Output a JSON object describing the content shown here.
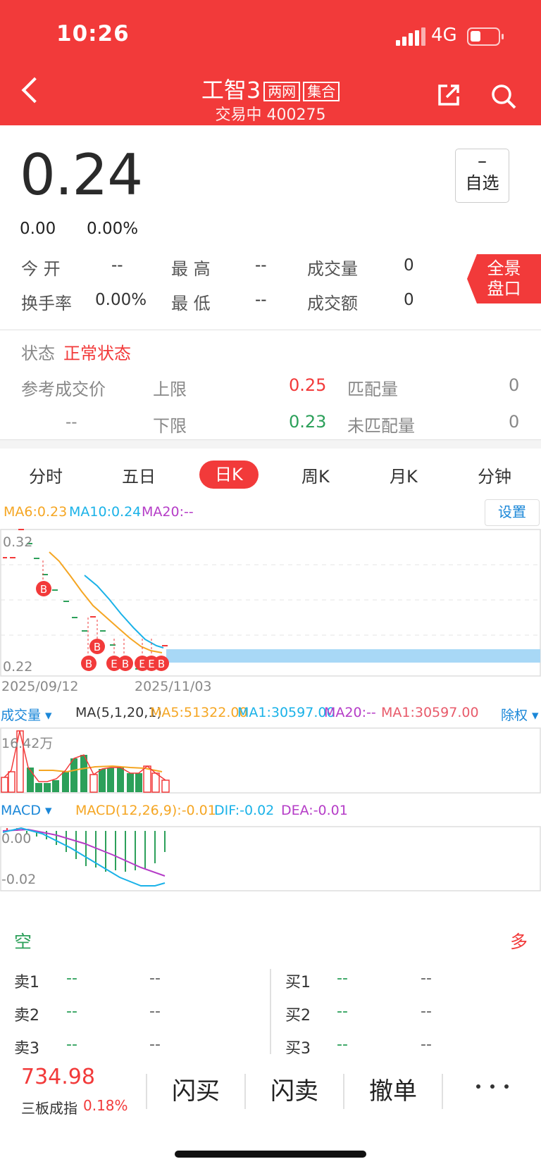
{
  "status_bar": {
    "time": "10:26",
    "network": "4G"
  },
  "header": {
    "title": "工智3",
    "tags": [
      "两网",
      "集合"
    ],
    "subtitle": "交易中 400275"
  },
  "quote": {
    "price": "0.24",
    "change": "0.00",
    "change_pct": "0.00%",
    "fav_mark": "–",
    "fav_label": "自选"
  },
  "stats": {
    "open_label": "今  开",
    "open": "--",
    "high_label": "最  高",
    "high": "--",
    "vol_label": "成交量",
    "vol": "0",
    "turnover_label": "换手率",
    "turnover": "0.00%",
    "low_label": "最  低",
    "low": "--",
    "amt_label": "成交额",
    "amt": "0",
    "panorama": [
      "全景",
      "盘口"
    ]
  },
  "status": {
    "label": "状态",
    "value": "正常状态",
    "ref_label": "参考成交价",
    "ref_value": "--",
    "upper_label": "上限",
    "upper": "0.25",
    "lower_label": "下限",
    "lower": "0.23",
    "matched_label": "匹配量",
    "matched": "0",
    "unmatched_label": "未匹配量",
    "unmatched": "0"
  },
  "tabs": [
    "分时",
    "五日",
    "日K",
    "周K",
    "月K",
    "分钟"
  ],
  "ma_line": {
    "ma6": "MA6:0.23",
    "ma10": "MA10:0.24",
    "ma20": "MA20:--",
    "settings": "设置"
  },
  "kchart": {
    "y_top": "0.32",
    "y_bottom": "0.22",
    "date_left": "2025/09/12",
    "date_right": "2025/11/03"
  },
  "volume": {
    "label": "成交量 ▾",
    "params": "MA(5,1,20,1)",
    "ma5": "MA5:51322.00",
    "ma1": "MA1:30597.00",
    "ma20": "MA20:--",
    "ma1b": "MA1:30597.00",
    "adj": "除权 ▾",
    "y_top": "16.42万"
  },
  "macd": {
    "label": "MACD ▾",
    "params": "MACD(12,26,9):-0.01",
    "dif": "DIF:-0.02",
    "dea": "DEA:-0.01",
    "y_top": "0.00",
    "y_bottom": "-0.02"
  },
  "orderbook": {
    "empty": "空",
    "long": "多",
    "sell": [
      {
        "label": "卖1",
        "price": "--",
        "vol": "--"
      },
      {
        "label": "卖2",
        "price": "--",
        "vol": "--"
      },
      {
        "label": "卖3",
        "price": "--",
        "vol": "--"
      }
    ],
    "buy": [
      {
        "label": "买1",
        "price": "--",
        "vol": "--"
      },
      {
        "label": "买2",
        "price": "--",
        "vol": "--"
      },
      {
        "label": "买3",
        "price": "--",
        "vol": "--"
      }
    ]
  },
  "bottom": {
    "index_value": "734.98",
    "index_name": "三板成指",
    "index_pct": "0.18%",
    "buy": "闪买",
    "sell": "闪卖",
    "cancel": "撤单"
  },
  "colors": {
    "up": "#f23a3a",
    "down": "#2ca05a",
    "ma6": "#f5a623",
    "ma10": "#1ab2e8",
    "ma20": "#b53cc7"
  }
}
